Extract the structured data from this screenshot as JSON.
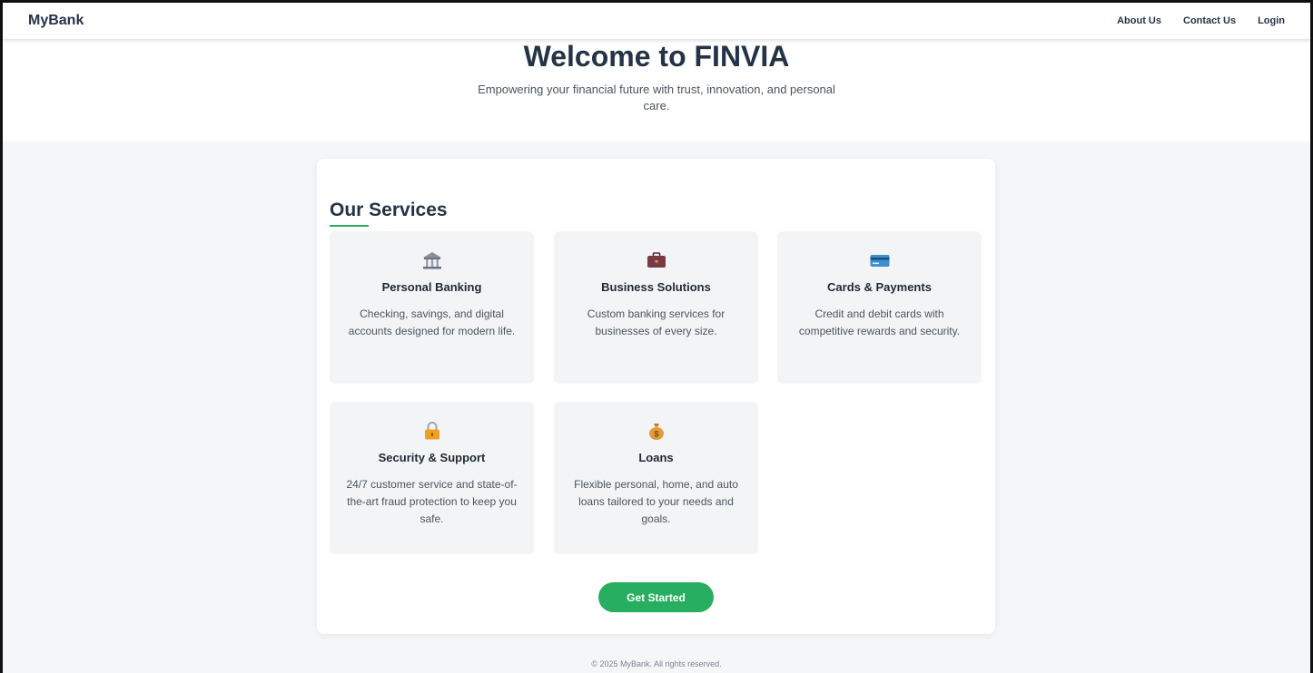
{
  "navbar": {
    "brand": "MyBank",
    "links": [
      "About Us",
      "Contact Us",
      "Login"
    ]
  },
  "hero": {
    "title": "Welcome to FINVIA",
    "subtitle": "Empowering your financial future with trust, innovation, and personal care."
  },
  "services": {
    "title": "Our Services",
    "items": [
      {
        "icon": "bank-icon",
        "title": "Personal Banking",
        "description": "Checking, savings, and digital accounts designed for modern life."
      },
      {
        "icon": "briefcase-icon",
        "title": "Business Solutions",
        "description": "Custom banking services for businesses of every size."
      },
      {
        "icon": "credit-card-icon",
        "title": "Cards & Payments",
        "description": "Credit and debit cards with competitive rewards and security."
      },
      {
        "icon": "lock-icon",
        "title": "Security & Support",
        "description": "24/7 customer service and state-of-the-art fraud protection to keep you safe."
      },
      {
        "icon": "money-bag-icon",
        "title": "Loans",
        "description": "Flexible personal, home, and auto loans tailored to your needs and goals."
      }
    ],
    "cta_label": "Get Started"
  },
  "footer": {
    "text": "© 2025 MyBank. All rights reserved."
  },
  "colors": {
    "accent": "#27ae60",
    "heading": "#243447",
    "card_bg": "#f3f4f5",
    "page_bg": "#f5f6f7"
  }
}
